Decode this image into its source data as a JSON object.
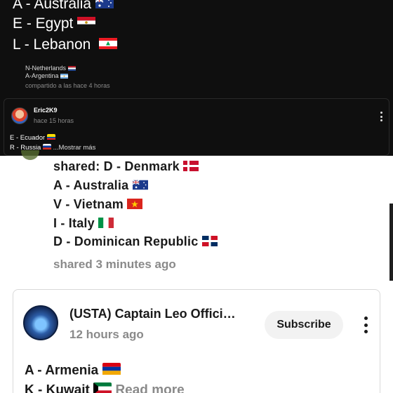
{
  "top": {
    "lines": [
      {
        "text": "A - Australia",
        "flag": "au-flag-icon"
      },
      {
        "text": "E - Egypt",
        "flag": "eg-flag-icon"
      },
      {
        "text": "L - Lebanon",
        "flag": "lb-flag-icon"
      }
    ],
    "reply": {
      "line1": "N-Netherlands",
      "line2": "A-Argentina",
      "meta": "compartido a las hace 4 horas"
    }
  },
  "comment_card": {
    "author": "Eric2K9",
    "time": "hace 15 horas",
    "line1": "E - Ecuador",
    "line2": "R - Russia",
    "more": "...Mostrar más"
  },
  "shared_post": {
    "lines": [
      {
        "text": "shared: D - Denmark",
        "flag": "dk-flag-icon"
      },
      {
        "text": "A - Australia",
        "flag": "au-flag-icon"
      },
      {
        "text": "V - Vietnam",
        "flag": "vn-flag-icon"
      },
      {
        "text": "I - Italy",
        "flag": "it-flag-icon"
      },
      {
        "text": "D - Dominican Republic",
        "flag": "do-flag-icon"
      }
    ],
    "meta": "shared 3 minutes ago"
  },
  "channel_post": {
    "channel_name": "(USTA) Captain Leo Offici…",
    "time": "12 hours ago",
    "subscribe_label": "Subscribe",
    "line1": "A - Armenia",
    "line2": "K - Kuwait",
    "more": "Read more"
  },
  "colors": {
    "dark_bg": "#0f0f0f",
    "white_bg": "#ffffff",
    "muted_text": "#8a8a8a"
  }
}
